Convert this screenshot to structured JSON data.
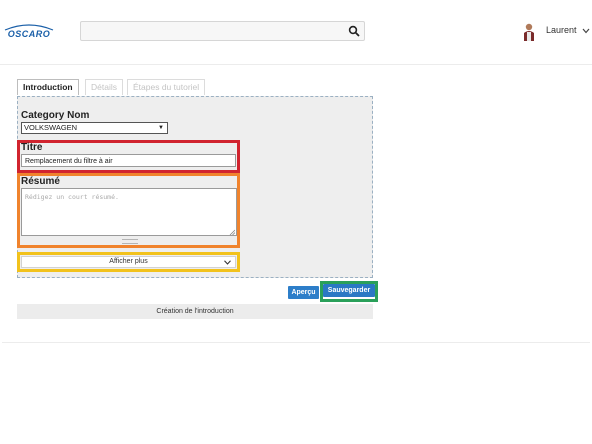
{
  "header": {
    "logo_text": "OSCARO",
    "search": {
      "value": "",
      "icon": "search-icon"
    },
    "user": {
      "name": "Laurent",
      "icon": "chevron-down-icon"
    }
  },
  "tabs": [
    {
      "label": "Introduction",
      "active": true
    },
    {
      "label": "Détails",
      "active": false
    },
    {
      "label": "Étapes du tutoriel",
      "active": false
    }
  ],
  "form": {
    "category_label": "Category Nom",
    "category_value": "VOLKSWAGEN",
    "title_label": "Titre",
    "title_value": "Remplacement du filtre à air",
    "summary_label": "Résumé",
    "summary_placeholder": "Rédigez un court résumé.",
    "more_label": "Afficher plus"
  },
  "actions": {
    "preview_label": "Aperçu",
    "save_label": "Sauvegarder"
  },
  "footer": {
    "label": "Création de l'introduction"
  },
  "colors": {
    "highlight_title": "#d1242f",
    "highlight_summary": "#f0832d",
    "highlight_more": "#f2c21c",
    "highlight_save": "#2aa05a",
    "button_blue": "#2d7ec9",
    "logo_blue": "#1a5fa8"
  }
}
